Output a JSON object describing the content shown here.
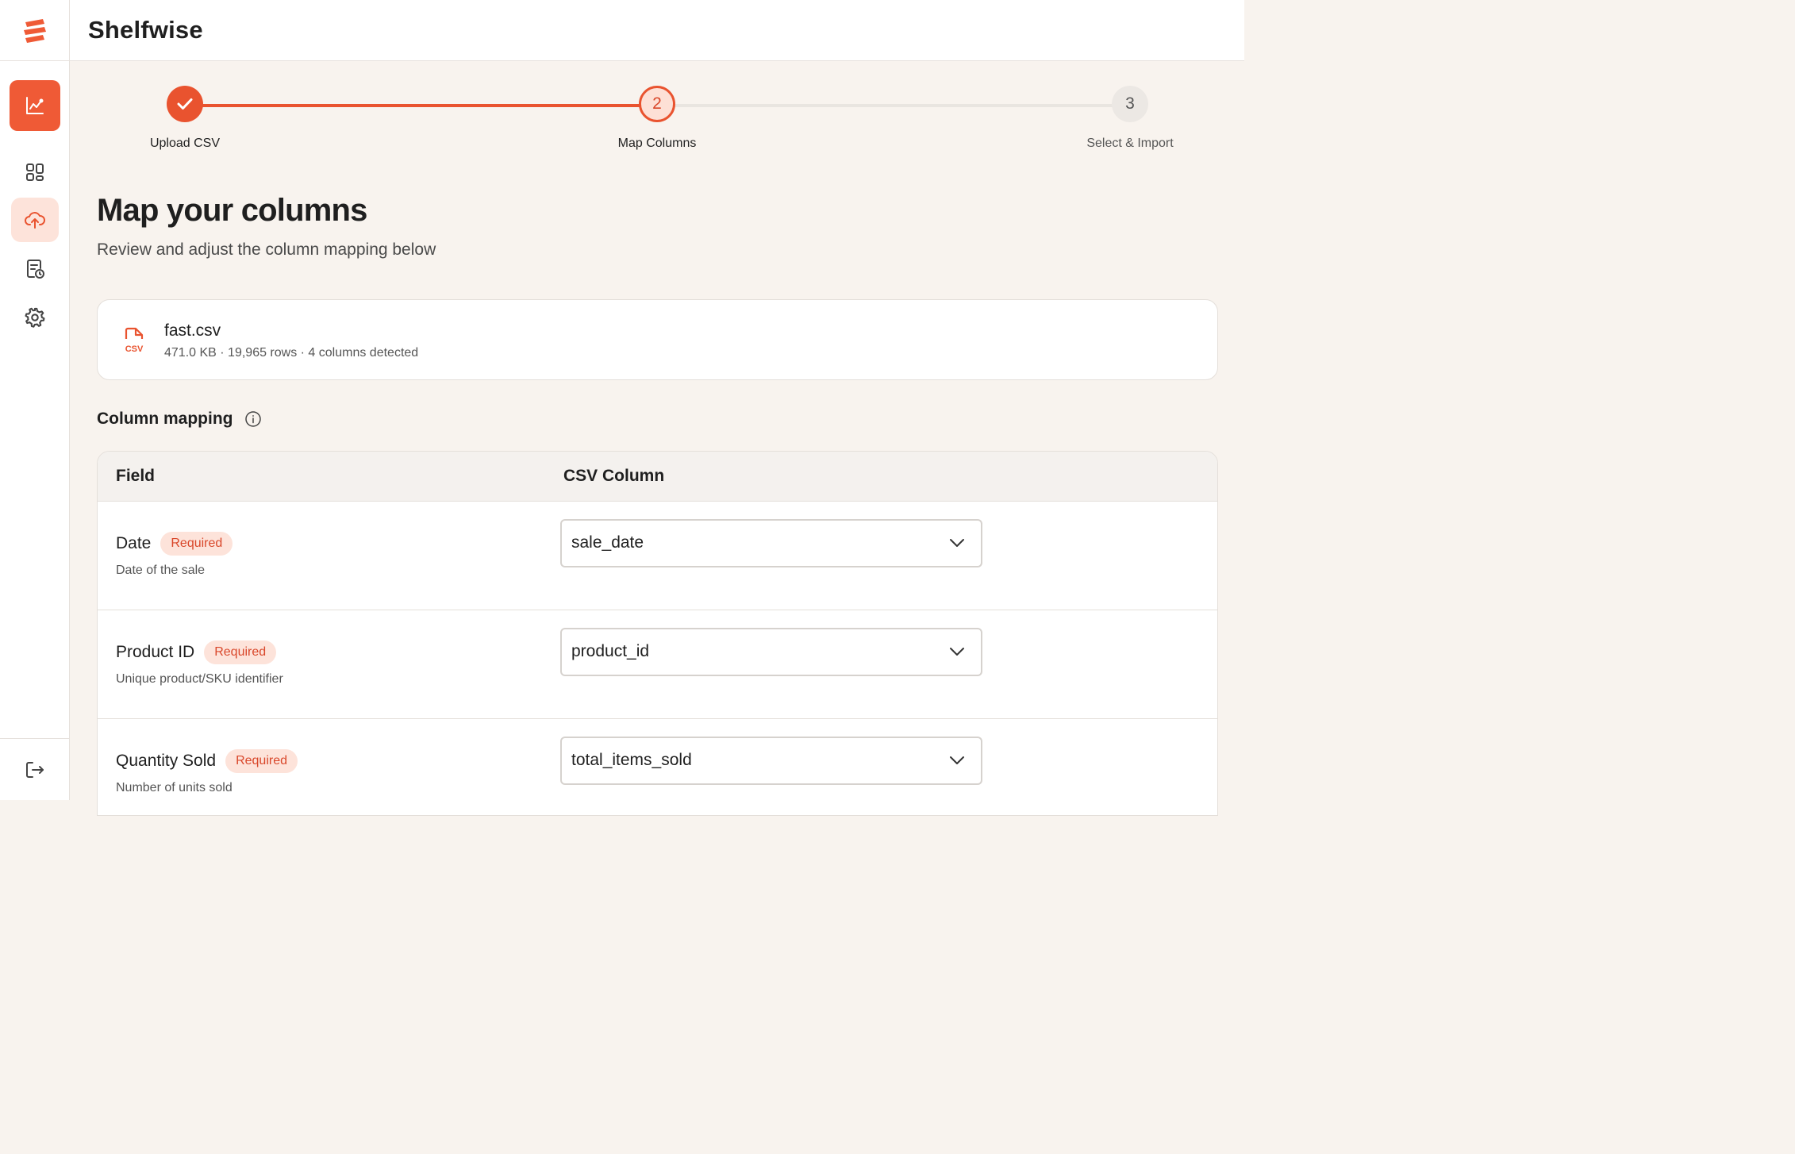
{
  "app": {
    "name": "Shelfwise"
  },
  "sidebar": {
    "items": [
      {
        "name": "analytics",
        "icon": "chart-icon"
      },
      {
        "name": "dashboard",
        "icon": "grid-icon"
      },
      {
        "name": "upload",
        "icon": "cloud-upload-icon"
      },
      {
        "name": "history",
        "icon": "document-clock-icon"
      },
      {
        "name": "settings",
        "icon": "gear-icon"
      }
    ],
    "bottom": {
      "name": "logout",
      "icon": "logout-icon"
    }
  },
  "stepper": {
    "steps": [
      {
        "number": "1",
        "label": "Upload CSV",
        "state": "complete"
      },
      {
        "number": "2",
        "label": "Map Columns",
        "state": "current"
      },
      {
        "number": "3",
        "label": "Select & Import",
        "state": "upcoming"
      }
    ]
  },
  "page": {
    "title": "Map your columns",
    "subtitle": "Review and adjust the column mapping below"
  },
  "file": {
    "icon_text": "CSV",
    "name": "fast.csv",
    "meta": "471.0 KB · 19,965 rows · 4 columns detected"
  },
  "mapping": {
    "section_title": "Column mapping",
    "headers": {
      "field": "Field",
      "csv_column": "CSV Column"
    },
    "rows": [
      {
        "field": "Date",
        "badge": "Required",
        "description": "Date of the sale",
        "selected": "sale_date"
      },
      {
        "field": "Product ID",
        "badge": "Required",
        "description": "Unique product/SKU identifier",
        "selected": "product_id"
      },
      {
        "field": "Quantity Sold",
        "badge": "Required",
        "description": "Number of units sold",
        "selected": "total_items_sold"
      }
    ]
  },
  "colors": {
    "accent": "#e9532f",
    "accent_soft": "#fde3da",
    "background": "#f8f3ee"
  }
}
